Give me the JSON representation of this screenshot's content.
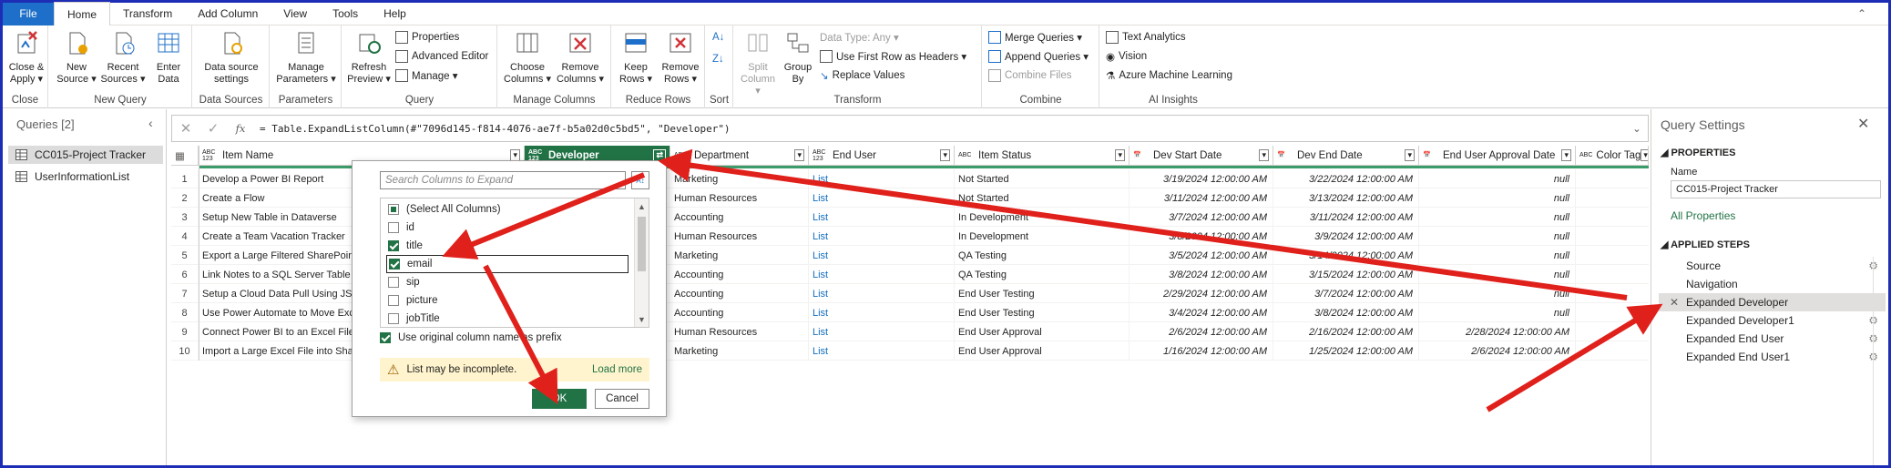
{
  "tabs": [
    "File",
    "Home",
    "Transform",
    "Add Column",
    "View",
    "Tools",
    "Help"
  ],
  "ribbon": {
    "groups": [
      {
        "label": "Close",
        "buttons": [
          {
            "label1": "Close &",
            "label2": "Apply ▾"
          }
        ]
      },
      {
        "label": "New Query",
        "buttons": [
          {
            "label1": "New",
            "label2": "Source ▾"
          },
          {
            "label1": "Recent",
            "label2": "Sources ▾"
          },
          {
            "label1": "Enter",
            "label2": "Data"
          }
        ]
      },
      {
        "label": "Data Sources",
        "buttons": [
          {
            "label1": "Data source",
            "label2": "settings"
          }
        ]
      },
      {
        "label": "Parameters",
        "buttons": [
          {
            "label1": "Manage",
            "label2": "Parameters ▾"
          }
        ]
      },
      {
        "label": "Query",
        "buttons": [
          {
            "label1": "Refresh",
            "label2": "Preview ▾"
          }
        ],
        "small": [
          "Properties",
          "Advanced Editor",
          "Manage ▾"
        ]
      },
      {
        "label": "Manage Columns",
        "buttons": [
          {
            "label1": "Choose",
            "label2": "Columns ▾"
          },
          {
            "label1": "Remove",
            "label2": "Columns ▾"
          }
        ]
      },
      {
        "label": "Reduce Rows",
        "buttons": [
          {
            "label1": "Keep",
            "label2": "Rows ▾"
          },
          {
            "label1": "Remove",
            "label2": "Rows ▾"
          }
        ]
      },
      {
        "label": "Sort",
        "buttons": []
      },
      {
        "label": "Transform",
        "buttons": [
          {
            "label1": "Split",
            "label2": "Column ▾"
          },
          {
            "label1": "Group",
            "label2": "By"
          }
        ],
        "small": [
          "Data Type: Any ▾",
          "Use First Row as Headers ▾",
          "Replace Values"
        ]
      },
      {
        "label": "Combine",
        "small": [
          "Merge Queries ▾",
          "Append Queries ▾",
          "Combine Files"
        ]
      },
      {
        "label": "AI Insights",
        "small": [
          "Text Analytics",
          "Vision",
          "Azure Machine Learning"
        ]
      }
    ]
  },
  "queries": {
    "title": "Queries [2]",
    "items": [
      "CC015-Project Tracker",
      "UserInformationList"
    ]
  },
  "formula": "= Table.ExpandListColumn(#\"7096d145-f814-4076-ae7f-b5a02d0c5bd5\", \"Developer\")",
  "columns": [
    {
      "type": "ABC\n123",
      "name": "Item Name"
    },
    {
      "type": "ABC\n123",
      "name": "Developer"
    },
    {
      "type": "ABC",
      "name": "Department"
    },
    {
      "type": "ABC\n123",
      "name": "End User"
    },
    {
      "type": "ABC",
      "name": "Item Status"
    },
    {
      "type": "cal",
      "name": "Dev Start Date"
    },
    {
      "type": "cal",
      "name": "Dev End Date"
    },
    {
      "type": "cal",
      "name": "End User Approval Date"
    },
    {
      "type": "ABC",
      "name": "Color Tag"
    }
  ],
  "rows": [
    {
      "n": "1",
      "item": "Develop a Power BI Report",
      "dept": "Marketing",
      "user": "List",
      "status": "Not Started",
      "start": "3/19/2024 12:00:00 AM",
      "end": "3/22/2024 12:00:00 AM",
      "appr": "null"
    },
    {
      "n": "2",
      "item": "Create a Flow",
      "dept": "Human Resources",
      "user": "List",
      "status": "Not Started",
      "start": "3/11/2024 12:00:00 AM",
      "end": "3/13/2024 12:00:00 AM",
      "appr": "null"
    },
    {
      "n": "3",
      "item": "Setup New Table in Dataverse",
      "dept": "Accounting",
      "user": "List",
      "status": "In Development",
      "start": "3/7/2024 12:00:00 AM",
      "end": "3/11/2024 12:00:00 AM",
      "appr": "null"
    },
    {
      "n": "4",
      "item": "Create a Team Vacation Tracker",
      "dept": "Human Resources",
      "user": "List",
      "status": "In Development",
      "start": "3/8/2024 12:00:00 AM",
      "end": "3/9/2024 12:00:00 AM",
      "appr": "null"
    },
    {
      "n": "5",
      "item": "Export a Large Filtered SharePoint",
      "dept": "Marketing",
      "user": "List",
      "status": "QA Testing",
      "start": "3/5/2024 12:00:00 AM",
      "end": "3/14/2024 12:00:00 AM",
      "appr": "null"
    },
    {
      "n": "6",
      "item": "Link Notes to a SQL Server Table in",
      "dept": "Accounting",
      "user": "List",
      "status": "QA Testing",
      "start": "3/8/2024 12:00:00 AM",
      "end": "3/15/2024 12:00:00 AM",
      "appr": "null"
    },
    {
      "n": "7",
      "item": "Setup a Cloud Data Pull Using JSON",
      "dept": "Accounting",
      "user": "List",
      "status": "End User Testing",
      "start": "2/29/2024 12:00:00 AM",
      "end": "3/7/2024 12:00:00 AM",
      "appr": "null"
    },
    {
      "n": "8",
      "item": "Use Power Automate to Move Exc",
      "dept": "Accounting",
      "user": "List",
      "status": "End User Testing",
      "start": "3/4/2024 12:00:00 AM",
      "end": "3/8/2024 12:00:00 AM",
      "appr": "null"
    },
    {
      "n": "9",
      "item": "Connect Power BI to an Excel File",
      "dept": "Human Resources",
      "user": "List",
      "status": "End User Approval",
      "start": "2/6/2024 12:00:00 AM",
      "end": "2/16/2024 12:00:00 AM",
      "appr": "2/28/2024 12:00:00 AM"
    },
    {
      "n": "10",
      "item": "Import a Large Excel File into Shar",
      "dept": "Marketing",
      "user": "List",
      "status": "End User Approval",
      "start": "1/16/2024 12:00:00 AM",
      "end": "1/25/2024 12:00:00 AM",
      "appr": "2/6/2024 12:00:00 AM"
    }
  ],
  "dropdown": {
    "search_placeholder": "Search Columns to Expand",
    "options": [
      {
        "label": "(Select All Columns)",
        "state": "partial"
      },
      {
        "label": "id",
        "state": "off"
      },
      {
        "label": "title",
        "state": "on"
      },
      {
        "label": "email",
        "state": "on"
      },
      {
        "label": "sip",
        "state": "off"
      },
      {
        "label": "picture",
        "state": "off"
      },
      {
        "label": "jobTitle",
        "state": "off"
      }
    ],
    "prefix_label": "Use original column name as prefix",
    "warning": "List may be incomplete.",
    "load_more": "Load more",
    "ok": "OK",
    "cancel": "Cancel"
  },
  "settings": {
    "title": "Query Settings",
    "properties_heading": "PROPERTIES",
    "name_label": "Name",
    "name_value": "CC015-Project Tracker",
    "all_properties": "All Properties",
    "steps_heading": "APPLIED STEPS",
    "steps": [
      "Source",
      "Navigation",
      "Expanded Developer",
      "Expanded Developer1",
      "Expanded End User",
      "Expanded End User1"
    ]
  },
  "colors": {
    "accent": "#217346",
    "file_tab": "#1e6fc9",
    "arrow": "#e0201b",
    "link": "#106ebe"
  }
}
